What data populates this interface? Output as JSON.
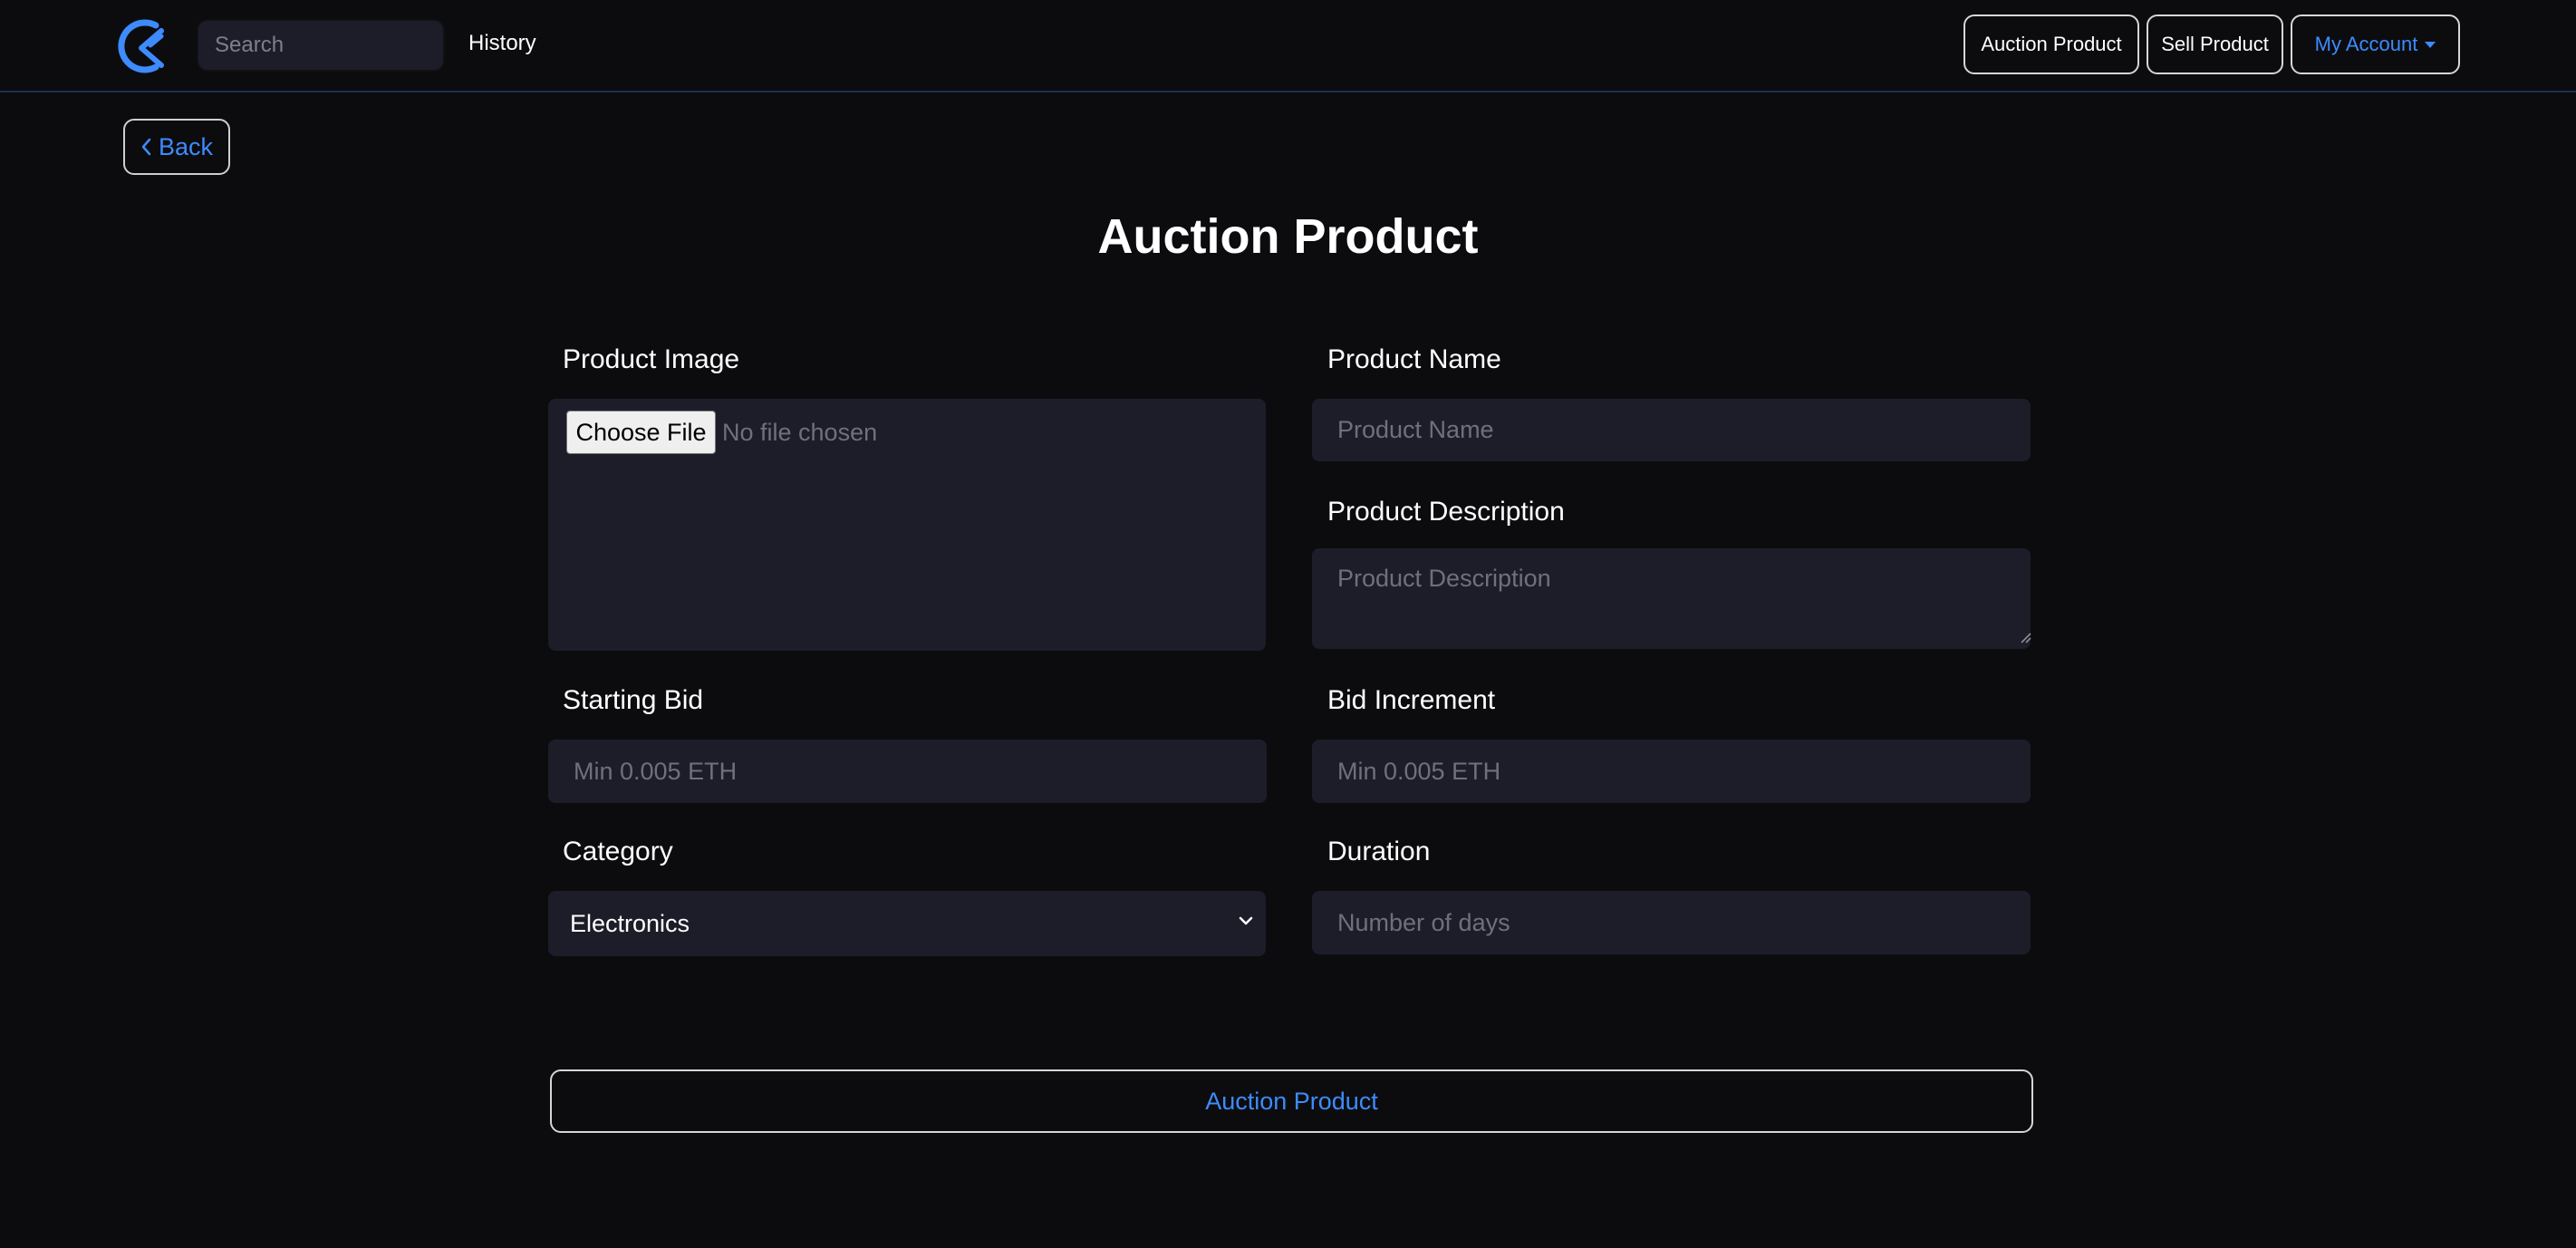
{
  "nav": {
    "search_placeholder": "Search",
    "history_label": "History",
    "auction_product_label": "Auction Product",
    "sell_product_label": "Sell Product",
    "my_account_label": "My Account"
  },
  "back_label": "Back",
  "page_title": "Auction Product",
  "form": {
    "product_image_label": "Product Image",
    "choose_file_label": "Choose File",
    "no_file_text": "No file chosen",
    "product_name_label": "Product Name",
    "product_name_placeholder": "Product Name",
    "product_description_label": "Product Description",
    "product_description_placeholder": "Product Description",
    "starting_bid_label": "Starting Bid",
    "starting_bid_placeholder": "Min 0.005 ETH",
    "bid_increment_label": "Bid Increment",
    "bid_increment_placeholder": "Min 0.005 ETH",
    "category_label": "Category",
    "category_selected": "Electronics",
    "duration_label": "Duration",
    "duration_placeholder": "Number of days",
    "submit_label": "Auction Product"
  },
  "colors": {
    "background": "#0c0c0f",
    "field_background": "#1d1d2a",
    "accent": "#3d8bfd"
  }
}
